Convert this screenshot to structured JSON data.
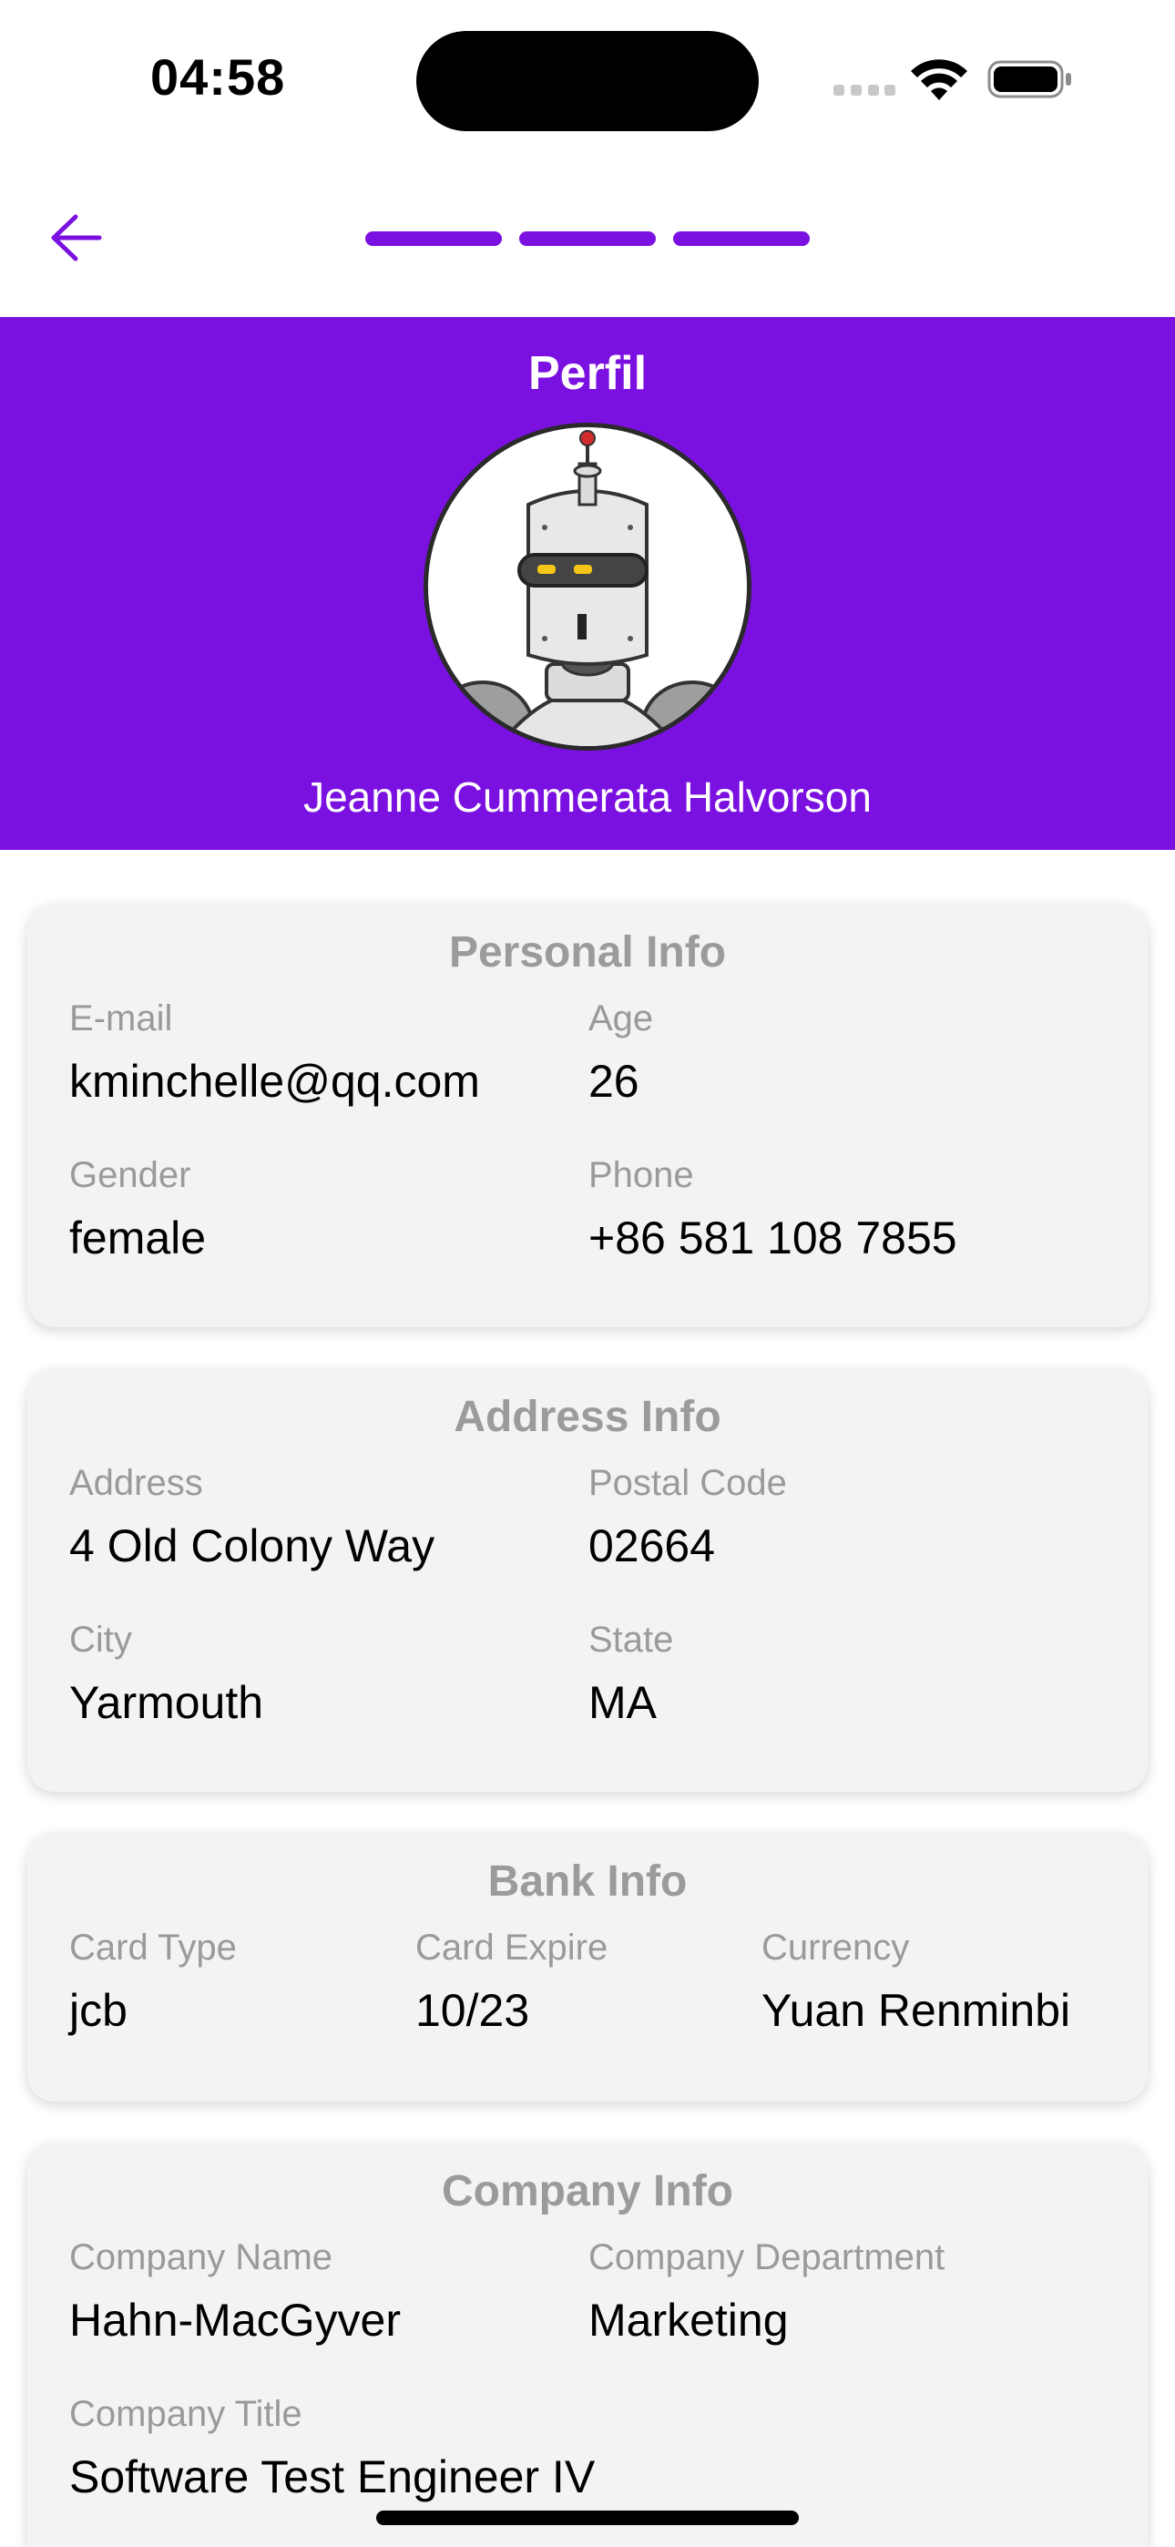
{
  "status_bar": {
    "time": "04:58"
  },
  "nav": {
    "back_icon": "arrow-left-icon",
    "progress_steps": 3,
    "accent_color": "#7b11e0"
  },
  "header": {
    "title": "Perfil",
    "avatar_icon": "robot-avatar",
    "name": "Jeanne Cummerata Halvorson",
    "background_color": "#7b11e0"
  },
  "personal_info": {
    "title": "Personal Info",
    "email_label": "E-mail",
    "email": "kminchelle@qq.com",
    "age_label": "Age",
    "age": "26",
    "gender_label": "Gender",
    "gender": "female",
    "phone_label": "Phone",
    "phone": "+86 581 108 7855"
  },
  "address_info": {
    "title": "Address Info",
    "address_label": "Address",
    "address": "4 Old Colony Way",
    "postal_label": "Postal Code",
    "postal": "02664",
    "city_label": "City",
    "city": "Yarmouth",
    "state_label": "State",
    "state": "MA"
  },
  "bank_info": {
    "title": "Bank Info",
    "card_type_label": "Card Type",
    "card_type": "jcb",
    "card_expire_label": "Card Expire",
    "card_expire": "10/23",
    "currency_label": "Currency",
    "currency": "Yuan Renminbi"
  },
  "company_info": {
    "title": "Company Info",
    "name_label": "Company Name",
    "name": "Hahn-MacGyver",
    "department_label": "Company Department",
    "department": "Marketing",
    "title_label": "Company Title",
    "job_title": "Software Test Engineer IV"
  }
}
